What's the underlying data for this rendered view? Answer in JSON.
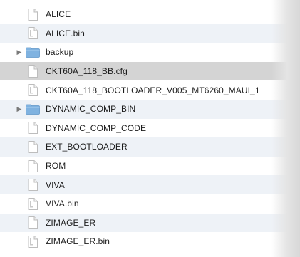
{
  "file_list": {
    "items": [
      {
        "name": "ALICE",
        "type": "document",
        "expandable": false,
        "selected": false
      },
      {
        "name": "ALICE.bin",
        "type": "binary",
        "expandable": false,
        "selected": false
      },
      {
        "name": "backup",
        "type": "folder",
        "expandable": true,
        "selected": false
      },
      {
        "name": "CKT60A_118_BB.cfg",
        "type": "document",
        "expandable": false,
        "selected": true
      },
      {
        "name": "CKT60A_118_BOOTLOADER_V005_MT6260_MAUI_1",
        "type": "binary",
        "expandable": false,
        "selected": false
      },
      {
        "name": "DYNAMIC_COMP_BIN",
        "type": "folder",
        "expandable": true,
        "selected": false
      },
      {
        "name": "DYNAMIC_COMP_CODE",
        "type": "document",
        "expandable": false,
        "selected": false
      },
      {
        "name": "EXT_BOOTLOADER",
        "type": "document",
        "expandable": false,
        "selected": false
      },
      {
        "name": "ROM",
        "type": "document",
        "expandable": false,
        "selected": false
      },
      {
        "name": "VIVA",
        "type": "document",
        "expandable": false,
        "selected": false
      },
      {
        "name": "VIVA.bin",
        "type": "binary",
        "expandable": false,
        "selected": false
      },
      {
        "name": "ZIMAGE_ER",
        "type": "document",
        "expandable": false,
        "selected": false
      },
      {
        "name": "ZIMAGE_ER.bin",
        "type": "binary",
        "expandable": false,
        "selected": false
      }
    ]
  },
  "icons": {
    "document": "document-icon",
    "binary": "binary-file-icon",
    "folder": "folder-icon",
    "disclosure": "disclosure-triangle-icon"
  },
  "colors": {
    "selection": "#d4d4d4",
    "alternate_row": "#eef2f7",
    "folder": "#7fb2e0",
    "text": "#1c1c1c"
  }
}
